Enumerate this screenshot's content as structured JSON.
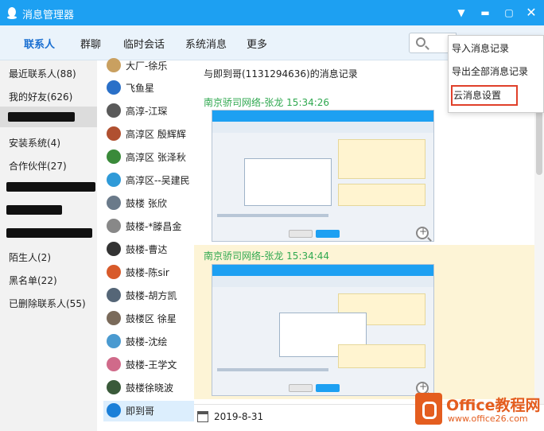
{
  "window": {
    "title": "消息管理器"
  },
  "tabs": [
    {
      "label": "联系人"
    },
    {
      "label": "群聊"
    },
    {
      "label": "临时会话"
    },
    {
      "label": "系统消息"
    },
    {
      "label": "更多"
    }
  ],
  "menu": {
    "items": [
      {
        "label": "导入消息记录"
      },
      {
        "label": "导出全部消息记录"
      },
      {
        "label": "云消息设置"
      }
    ]
  },
  "groups": [
    {
      "label": "最近联系人(88)"
    },
    {
      "label": "我的好友(626)"
    },
    {
      "label": "安装系统(4)"
    },
    {
      "label": "合作伙伴(27)"
    },
    {
      "label": "陌生人(2)"
    },
    {
      "label": "黑名单(22)"
    },
    {
      "label": "已删除联系人(55)"
    }
  ],
  "contacts": [
    {
      "name": "大厂-徐乐",
      "color": "#c9a060"
    },
    {
      "name": "飞鱼星",
      "color": "#2a70c8"
    },
    {
      "name": "高淳-江琛",
      "color": "#5a5a5a"
    },
    {
      "name": "高淳区 殷辉辉",
      "color": "#b05030"
    },
    {
      "name": "高淳区 张泽秋",
      "color": "#3a8a3a"
    },
    {
      "name": "高淳区--吴建民",
      "color": "#2f9ad8"
    },
    {
      "name": "鼓楼 张欣",
      "color": "#6a7a8a"
    },
    {
      "name": "鼓楼-*滕昌金",
      "color": "#888888"
    },
    {
      "name": "鼓楼-曹达",
      "color": "#333333"
    },
    {
      "name": "鼓楼-陈sir",
      "color": "#d85a2a"
    },
    {
      "name": "鼓楼-胡方凯",
      "color": "#556677"
    },
    {
      "name": "鼓楼区 徐星",
      "color": "#7a6a5a"
    },
    {
      "name": "鼓楼-沈绘",
      "color": "#4a9ad0"
    },
    {
      "name": "鼓楼-王学文",
      "color": "#d06a8a"
    },
    {
      "name": "鼓楼徐晓波",
      "color": "#3a5a3a"
    },
    {
      "name": "即到哥",
      "color": "#1a7fd8"
    }
  ],
  "records": {
    "heading": "与即到哥(1131294636)的消息记录",
    "messages": [
      {
        "sender": "南京骄司网络-张龙",
        "time": "15:34:26"
      },
      {
        "sender": "南京骄司网络-张龙",
        "time": "15:34:44"
      }
    ],
    "date": "2019-8-31"
  },
  "watermark": {
    "brand": "Office教程网",
    "url": "www.office26.com"
  }
}
